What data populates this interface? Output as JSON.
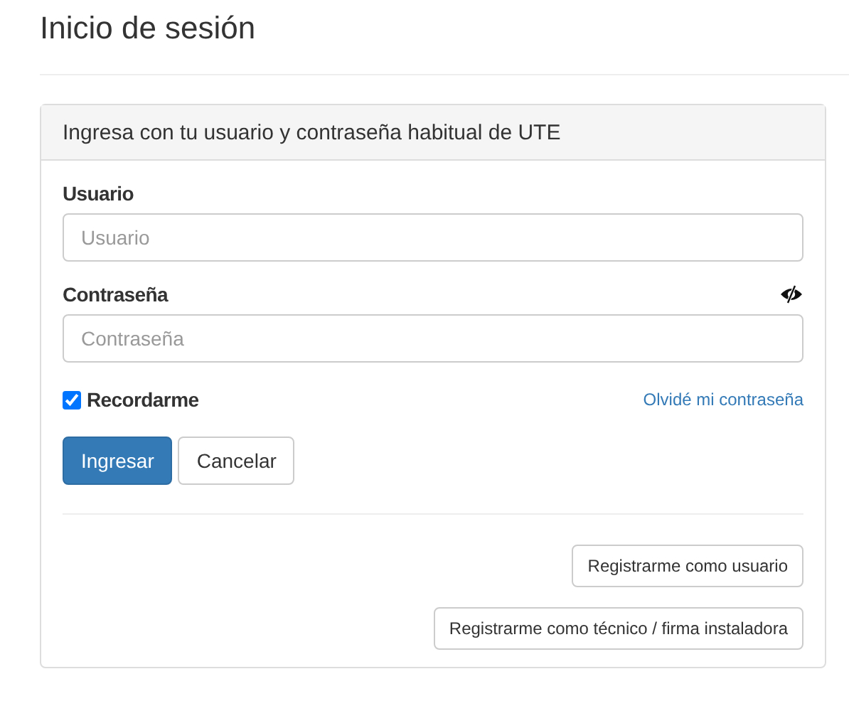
{
  "page": {
    "title": "Inicio de sesión"
  },
  "panel": {
    "heading": "Ingresa con tu usuario y contraseña habitual de UTE"
  },
  "fields": [
    {
      "kind": "text",
      "label": "Usuario",
      "placeholder": "Usuario"
    },
    {
      "kind": "password",
      "label": "Contraseña",
      "placeholder": "Contraseña"
    }
  ],
  "remember": {
    "label": "Recordarme",
    "checked": true
  },
  "forgot_link": "Olvidé mi contraseña",
  "actions": [
    {
      "label": "Ingresar",
      "kind": "primary"
    },
    {
      "label": "Cancelar",
      "kind": "default"
    }
  ],
  "register_buttons": [
    "Registrarme como usuario",
    "Registrarme como técnico / firma instaladora"
  ]
}
